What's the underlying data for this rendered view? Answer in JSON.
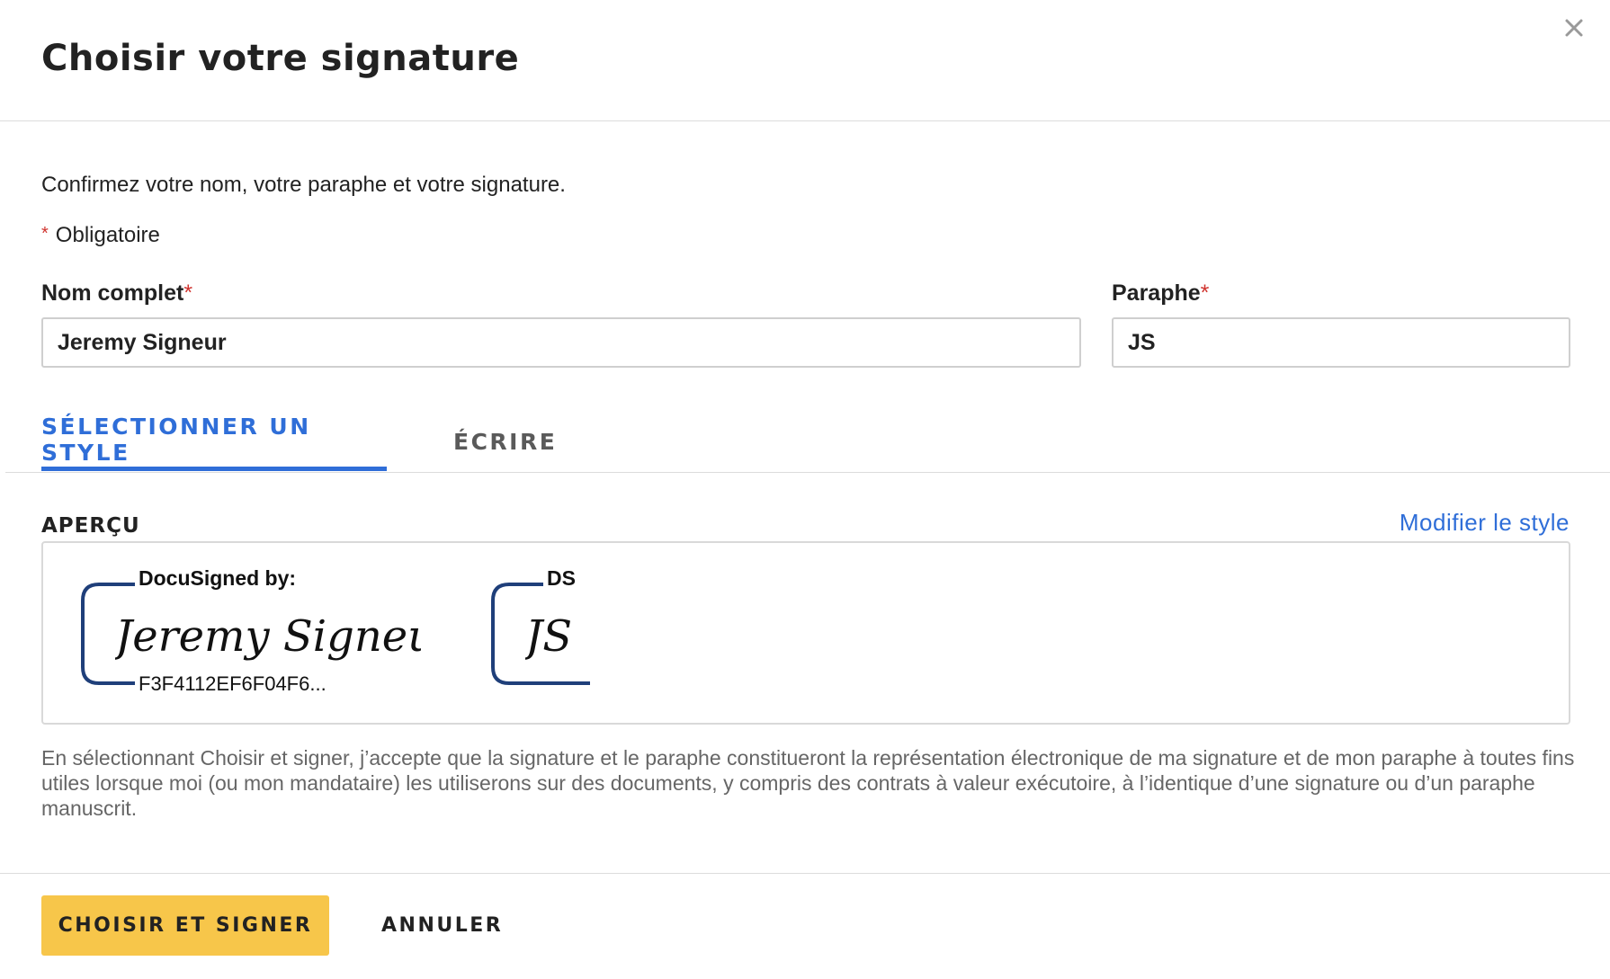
{
  "dialog": {
    "title": "Choisir votre signature",
    "close_icon": "close-icon"
  },
  "form": {
    "intro": "Confirmez votre nom, votre paraphe et votre signature.",
    "required_mark": "*",
    "required_note": "Obligatoire",
    "full_name": {
      "label": "Nom complet",
      "value": "Jeremy Signeur"
    },
    "initials": {
      "label": "Paraphe",
      "value": "JS"
    }
  },
  "tabs": [
    {
      "label": "SÉLECTIONNER UN STYLE",
      "active": true
    },
    {
      "label": "ÉCRIRE",
      "active": false
    }
  ],
  "preview": {
    "label": "APERÇU",
    "modify_link": "Modifier le style",
    "signature": {
      "header": "DocuSigned by:",
      "script_text": "Jeremy Signeur",
      "hash": "F3F4112EF6F04F6..."
    },
    "initials": {
      "header": "DS",
      "script_text": "JS"
    },
    "frame_color": "#1f3f7a"
  },
  "disclaimer": "En sélectionnant Choisir et signer, j’accepte que la signature et le paraphe constitueront la représentation électronique de ma signature et de mon paraphe à toutes fins utiles lorsque moi (ou mon mandataire) les utiliserons sur des documents, y compris des contrats à valeur exécutoire, à l’identique d’une signature ou d’un paraphe manuscrit.",
  "footer": {
    "primary_button": "CHOISIR ET SIGNER",
    "secondary_button": "ANNULER"
  },
  "colors": {
    "accent": "#2f6ed8",
    "primary_button": "#f7c64a",
    "required": "#d0332e"
  }
}
